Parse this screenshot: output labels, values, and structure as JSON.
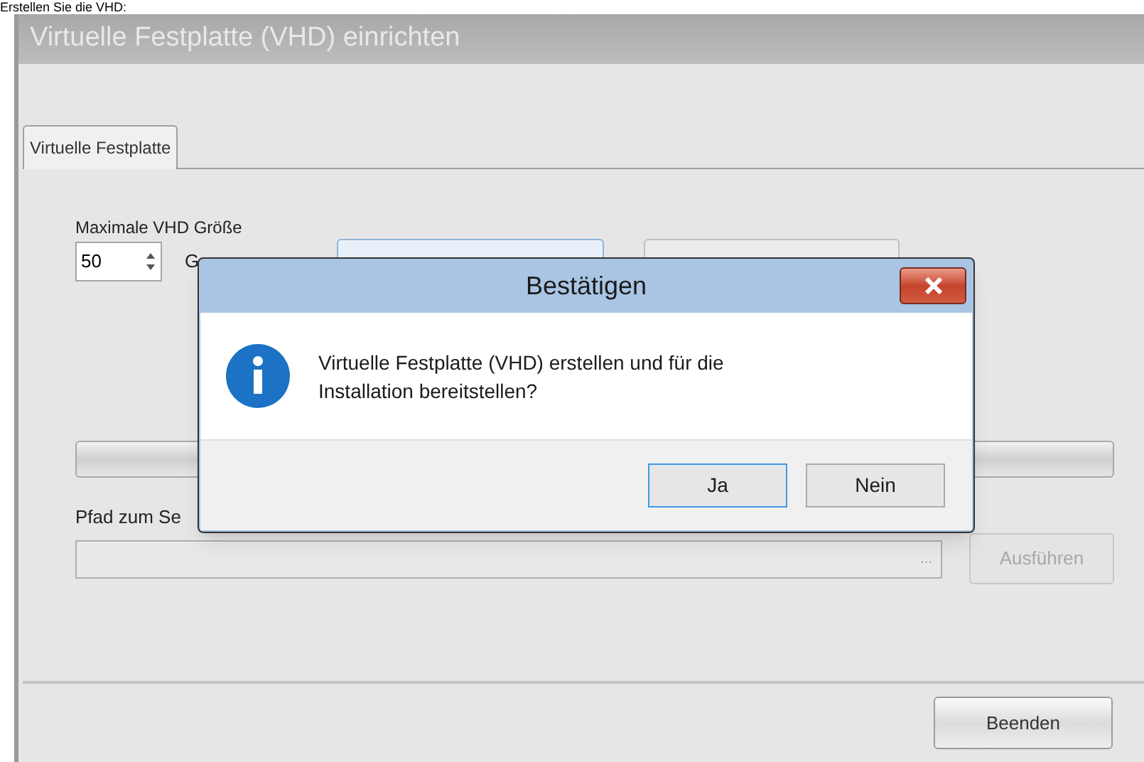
{
  "heading": "Erstellen Sie die VHD:",
  "window": {
    "title": "Virtuelle Festplatte (VHD) einrichten"
  },
  "tabs": [
    {
      "label": "Virtuelle Festplatte",
      "selected": true
    }
  ],
  "size_label": "Maximale VHD Größe",
  "size_field": {
    "value": "50"
  },
  "unit_label": "G",
  "progress": {
    "level": 0
  },
  "path_label": "Pfad zum Se",
  "path_field": {
    "browse": "..."
  },
  "run_button": {
    "label": "Ausführen",
    "disabled": true
  },
  "close_button": {
    "label": "Beenden"
  },
  "dialog": {
    "title": "Bestätigen",
    "message": "Virtuelle Festplatte (VHD) erstellen und für die Installation bereitstellen?",
    "buttons": [
      {
        "label": "Ja",
        "selected": true
      },
      {
        "label": "Nein",
        "selected": false
      }
    ]
  }
}
